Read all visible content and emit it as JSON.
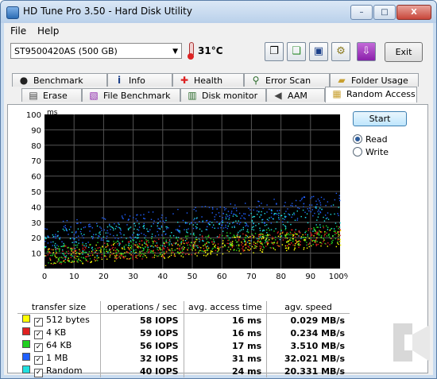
{
  "window": {
    "title": "HD Tune Pro 3.50 - Hard Disk Utility",
    "buttons": [
      "–",
      "□",
      "X"
    ]
  },
  "menu": [
    "File",
    "Help"
  ],
  "toolbar": {
    "drive": "ST9500420AS (500 GB)",
    "temperature": "31°C",
    "exit_label": "Exit",
    "icons": [
      "copy-icon",
      "copy-text-icon",
      "save-icon",
      "options-icon",
      "download-icon"
    ]
  },
  "tabs_top": [
    {
      "label": "Benchmark",
      "icon": "benchmark-icon"
    },
    {
      "label": "Info",
      "icon": "info-icon"
    },
    {
      "label": "Health",
      "icon": "health-icon"
    },
    {
      "label": "Error Scan",
      "icon": "error-scan-icon"
    },
    {
      "label": "Folder Usage",
      "icon": "folder-usage-icon"
    }
  ],
  "tabs_bottom": [
    {
      "label": "Erase",
      "icon": "erase-icon"
    },
    {
      "label": "File Benchmark",
      "icon": "file-benchmark-icon"
    },
    {
      "label": "Disk monitor",
      "icon": "disk-monitor-icon"
    },
    {
      "label": "AAM",
      "icon": "aam-icon"
    },
    {
      "label": "Random Access",
      "icon": "random-access-icon"
    }
  ],
  "active_tab": "Random Access",
  "controls": {
    "start_label": "Start",
    "read_label": "Read",
    "write_label": "Write",
    "mode": "Read"
  },
  "chart_data": {
    "type": "scatter",
    "ylabel": "ms",
    "ylim": [
      0,
      100
    ],
    "xlim": [
      0,
      100
    ],
    "y_ticks": [
      "100",
      "90",
      "80",
      "70",
      "60",
      "50",
      "40",
      "30",
      "20",
      "10"
    ],
    "x_ticks": [
      "0",
      "10",
      "20",
      "30",
      "40",
      "50",
      "60",
      "70",
      "80",
      "90",
      "100%"
    ],
    "grid": true,
    "series": [
      {
        "name": "512 bytes",
        "color": "#ffff00",
        "base": [
          8,
          20
        ],
        "spread": 6
      },
      {
        "name": "4 KB",
        "color": "#e02020",
        "base": [
          8,
          22
        ],
        "spread": 6
      },
      {
        "name": "64 KB",
        "color": "#20d020",
        "base": [
          9,
          23
        ],
        "spread": 6
      },
      {
        "name": "1 MB",
        "color": "#2060ff",
        "base": [
          22,
          42
        ],
        "spread": 8
      },
      {
        "name": "Random",
        "color": "#20e0e0",
        "base": [
          15,
          32
        ],
        "spread": 10
      }
    ]
  },
  "results": {
    "headers": [
      "transfer size",
      "operations / sec",
      "avg. access time",
      "agv. speed"
    ],
    "rows": [
      {
        "size": "512 bytes",
        "color": "#ffff00",
        "ops": "58 IOPS",
        "time": "16 ms",
        "speed": "0.029 MB/s"
      },
      {
        "size": "4 KB",
        "color": "#e02020",
        "ops": "59 IOPS",
        "time": "16 ms",
        "speed": "0.234 MB/s"
      },
      {
        "size": "64 KB",
        "color": "#20d020",
        "ops": "56 IOPS",
        "time": "17 ms",
        "speed": "3.510 MB/s"
      },
      {
        "size": "1 MB",
        "color": "#2060ff",
        "ops": "32 IOPS",
        "time": "31 ms",
        "speed": "32.021 MB/s"
      },
      {
        "size": "Random",
        "color": "#20e0e0",
        "ops": "40 IOPS",
        "time": "24 ms",
        "speed": "20.331 MB/s"
      }
    ]
  }
}
